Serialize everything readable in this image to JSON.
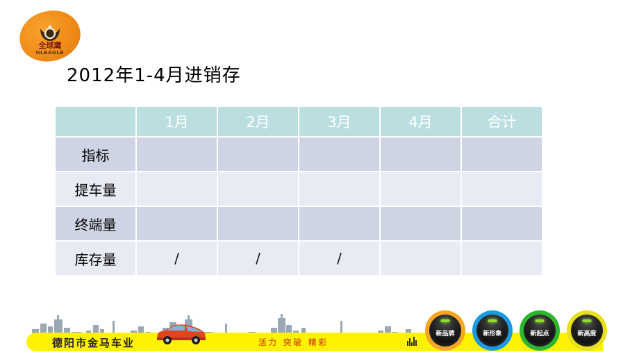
{
  "logo": {
    "name": "gleagle-logo",
    "cn_text": "全球鹰",
    "en_text": "GLEAGLE",
    "color": "#f0921c"
  },
  "title": "2012年1-4月进销存",
  "table": {
    "headers": [
      "",
      "1月",
      "2月",
      "3月",
      "4月",
      "合计"
    ],
    "header_bg": "#bbdee1",
    "header_text_color": "#ffffff",
    "row_bg_dark": "#ced4e4",
    "row_bg_light": "#e8ebf4",
    "rows": [
      {
        "label": "指标",
        "values": [
          "",
          "",
          "",
          "",
          ""
        ]
      },
      {
        "label": "提车量",
        "values": [
          "",
          "",
          "",
          "",
          ""
        ]
      },
      {
        "label": "终端量",
        "values": [
          "",
          "",
          "",
          "",
          ""
        ]
      },
      {
        "label": "库存量",
        "values": [
          "/",
          "/",
          "/",
          "",
          ""
        ]
      }
    ]
  },
  "banner": {
    "bar_color": "#fff200",
    "shop_name": "德阳市金马车业",
    "slogan": "活力 突破 精彩",
    "slogan_color": "#d06a10",
    "eq_icon": "equalizer-icon",
    "car_icon": "red-car-icon",
    "skyline_icon": "city-skyline-icon",
    "badges": [
      {
        "label": "新品牌",
        "ring": "#f5a623"
      },
      {
        "label": "新形象",
        "ring": "#1b9ae0"
      },
      {
        "label": "新起点",
        "ring": "#2db52d"
      },
      {
        "label": "新高度",
        "ring": "#e8e01a"
      }
    ]
  }
}
